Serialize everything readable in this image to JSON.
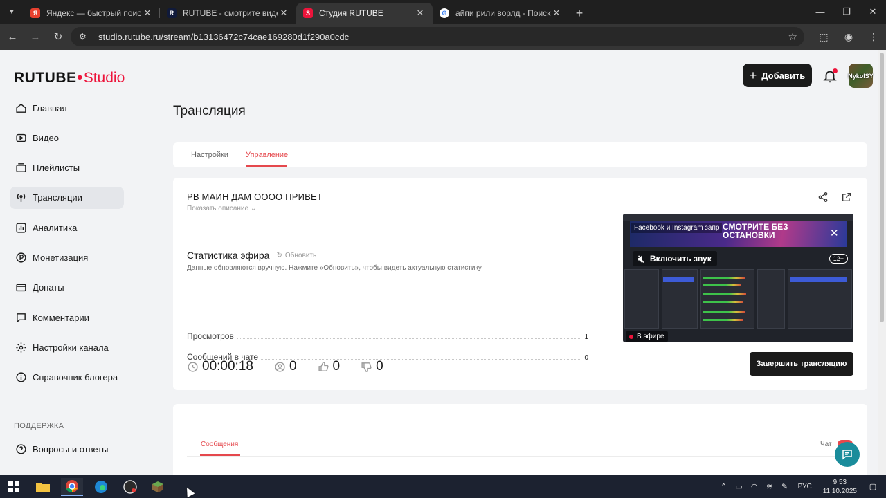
{
  "browser": {
    "tabs": [
      {
        "title": "Яндекс — быстрый поиск в ин",
        "favicon": "yandex-icon",
        "favicon_letter": "Я",
        "color": "#e8412f",
        "active": false
      },
      {
        "title": "RUTUBE - смотрите видео онл",
        "favicon": "rutube-icon",
        "favicon_letter": "R",
        "color": "#101a3a",
        "active": false
      },
      {
        "title": "Студия RUTUBE",
        "favicon": "rutube-studio-icon",
        "favicon_letter": "S",
        "color": "#ed143b",
        "active": true
      },
      {
        "title": "айпи рили ворлд - Поиск в Go",
        "favicon": "google-icon",
        "favicon_letter": "G",
        "color": "#4285f4",
        "active": false
      }
    ],
    "url": "studio.rutube.ru/stream/b13136472c74cae169280d1f290a0cdc"
  },
  "logo": {
    "brand": "RUTUBE",
    "product": "Studio"
  },
  "sidebar": {
    "items": [
      {
        "label": "Главная",
        "icon": "home-icon"
      },
      {
        "label": "Видео",
        "icon": "video-icon"
      },
      {
        "label": "Плейлисты",
        "icon": "playlist-icon"
      },
      {
        "label": "Трансляции",
        "icon": "broadcast-icon",
        "active": true
      },
      {
        "label": "Аналитика",
        "icon": "analytics-icon"
      },
      {
        "label": "Монетизация",
        "icon": "money-icon"
      },
      {
        "label": "Донаты",
        "icon": "donate-icon"
      },
      {
        "label": "Комментарии",
        "icon": "comment-icon"
      },
      {
        "label": "Настройки канала",
        "icon": "gear-icon"
      },
      {
        "label": "Справочник блогера",
        "icon": "info-icon"
      }
    ],
    "section_support": "ПОДДЕРЖКА",
    "faq": "Вопросы и ответы"
  },
  "header": {
    "add_button": "Добавить",
    "avatar_text": "NykolSY"
  },
  "page": {
    "title": "Трансляция",
    "tabs": {
      "settings": "Настройки",
      "manage": "Управление"
    }
  },
  "stream": {
    "title": "РВ МАИН ДАМ ОООО ПРИВЕТ",
    "show_description": "Показать описание",
    "stats_title": "Статистика эфира",
    "refresh": "Обновить",
    "stats_note": "Данные обновляются вручную. Нажмите «Обновить», чтобы видеть актуальную статистику",
    "views_label": "Просмотров",
    "views_value": "1",
    "chat_label": "Сообщений в чате",
    "chat_value": "0",
    "duration": "00:00:18",
    "viewers": "0",
    "likes": "0",
    "dislikes": "0",
    "end_button": "Завершить трансляцию"
  },
  "preview": {
    "ad_left": "Facebook и Instagram запр",
    "ad_right": "СМОТРИТЕ БЕЗ ОСТАНОВКИ",
    "unmute": "Включить звук",
    "age": "12+",
    "live": "В эфире"
  },
  "chat": {
    "tab": "Сообщения",
    "label": "Чат"
  },
  "taskbar": {
    "lang": "РУС",
    "time": "9:53",
    "date": "11.10.2025"
  },
  "colors": {
    "accent": "#ed143b",
    "tab_active": "#e5484d",
    "dark_button": "#1b1b1b",
    "help_fab": "#1a8c9b"
  }
}
